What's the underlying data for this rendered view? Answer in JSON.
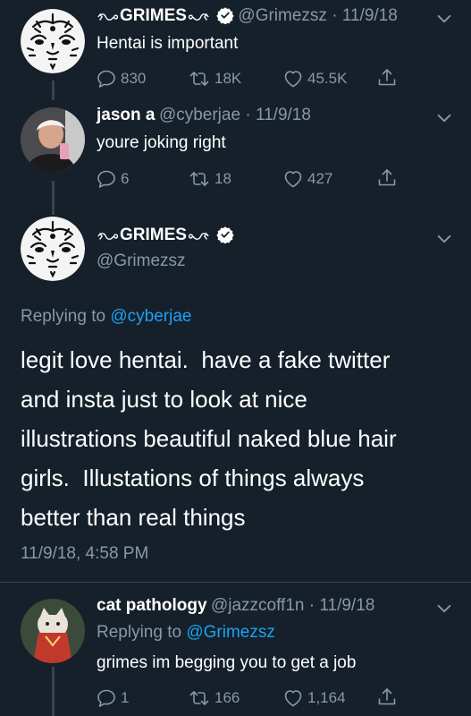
{
  "tweets": [
    {
      "name": "GRIMES",
      "handle": "@Grimezsz",
      "date": "11/9/18",
      "text": "Hentai is important",
      "replies": "830",
      "retweets": "18K",
      "likes": "45.5K"
    },
    {
      "name": "jason a",
      "handle": "@cyberjae",
      "date": "11/9/18",
      "text": "youre joking right",
      "replies": "6",
      "retweets": "18",
      "likes": "427"
    }
  ],
  "main": {
    "name": "GRIMES",
    "handle": "@Grimezsz",
    "replying_prefix": "Replying to",
    "replying_to": "@cyberjae",
    "text_lines": [
      "legit love hentai.  have a fake twitter",
      "and insta just to look at nice",
      "illustrations beautiful naked blue hair",
      "girls.  Illustations of things always",
      "better than real things"
    ],
    "timestamp": "11/9/18, 4:58 PM"
  },
  "reply": {
    "name": "cat pathology",
    "handle": "@jazzcoff1n",
    "date": "11/9/18",
    "replying_prefix": "Replying to",
    "replying_to": "@Grimezsz",
    "text": "grimes im begging you to get a job",
    "replies": "1",
    "retweets": "166",
    "likes": "1,164"
  },
  "colors": {
    "background": "#15202b",
    "secondary_text": "#8899a6",
    "accent": "#1da1f2",
    "divider": "#38444d"
  },
  "icons": [
    "reply-icon",
    "retweet-icon",
    "like-icon",
    "share-icon",
    "chevron-down-icon",
    "verified-badge-icon",
    "ornament-icon"
  ]
}
